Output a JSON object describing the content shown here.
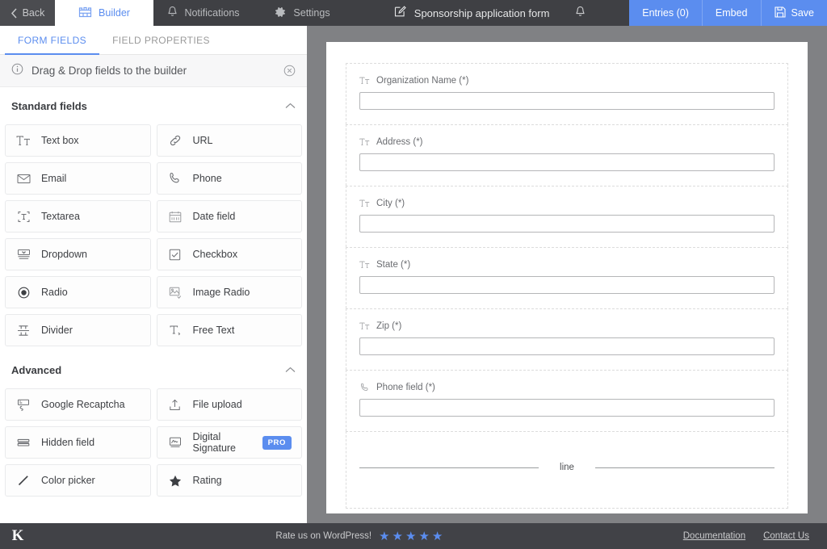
{
  "topbar": {
    "back_label": "Back",
    "tabs": [
      {
        "label": "Builder",
        "icon": "builder-icon",
        "active": true
      },
      {
        "label": "Notifications",
        "icon": "bell-icon",
        "active": false
      },
      {
        "label": "Settings",
        "icon": "gear-icon",
        "active": false
      }
    ],
    "form_title": "Sponsorship application form",
    "title_icon": "edit-pencil-icon",
    "bell_icon": "bell-icon",
    "actions": [
      {
        "label": "Entries (0)",
        "icon": null
      },
      {
        "label": "Embed",
        "icon": null
      },
      {
        "label": "Save",
        "icon": "save-disk-icon"
      }
    ],
    "accent_color": "#5b8def",
    "bar_color": "#3f4044"
  },
  "sidebar": {
    "tabs": [
      {
        "label": "FORM FIELDS",
        "active": true
      },
      {
        "label": "FIELD PROPERTIES",
        "active": false
      }
    ],
    "hint": {
      "text": "Drag & Drop fields to the builder",
      "info_icon": "info-circle-icon",
      "close_icon": "close-circle-icon"
    },
    "groups": [
      {
        "title": "Standard fields",
        "chevron": "chevron-up-icon",
        "fields": [
          {
            "label": "Text box",
            "icon": "text-box-icon"
          },
          {
            "label": "URL",
            "icon": "link-icon"
          },
          {
            "label": "Email",
            "icon": "envelope-icon"
          },
          {
            "label": "Phone",
            "icon": "phone-icon"
          },
          {
            "label": "Textarea",
            "icon": "textarea-icon"
          },
          {
            "label": "Date field",
            "icon": "calendar-icon"
          },
          {
            "label": "Dropdown",
            "icon": "dropdown-icon"
          },
          {
            "label": "Checkbox",
            "icon": "checkbox-icon"
          },
          {
            "label": "Radio",
            "icon": "radio-icon"
          },
          {
            "label": "Image Radio",
            "icon": "image-radio-icon"
          },
          {
            "label": "Divider",
            "icon": "divider-icon"
          },
          {
            "label": "Free Text",
            "icon": "free-text-icon"
          }
        ]
      },
      {
        "title": "Advanced",
        "chevron": "chevron-up-icon",
        "fields": [
          {
            "label": "Google Recaptcha",
            "icon": "recaptcha-icon"
          },
          {
            "label": "File upload",
            "icon": "upload-icon"
          },
          {
            "label": "Hidden field",
            "icon": "hidden-icon"
          },
          {
            "label": "Digital Signature",
            "icon": "signature-icon",
            "badge": "PRO"
          },
          {
            "label": "Color picker",
            "icon": "pencil-icon"
          },
          {
            "label": "Rating",
            "icon": "star-icon"
          }
        ]
      }
    ]
  },
  "canvas": {
    "fields": [
      {
        "type": "text",
        "label": "Organization Name (*)",
        "icon": "text-box-icon",
        "value": ""
      },
      {
        "type": "text",
        "label": "Address (*)",
        "icon": "text-box-icon",
        "value": ""
      },
      {
        "type": "text",
        "label": "City (*)",
        "icon": "text-box-icon",
        "value": ""
      },
      {
        "type": "text",
        "label": "State (*)",
        "icon": "text-box-icon",
        "value": ""
      },
      {
        "type": "text",
        "label": "Zip (*)",
        "icon": "text-box-icon",
        "value": ""
      },
      {
        "type": "phone",
        "label": "Phone field (*)",
        "icon": "phone-icon",
        "value": ""
      },
      {
        "type": "divider",
        "label": "line",
        "icon": "divider-icon"
      }
    ]
  },
  "footer": {
    "logo": "K",
    "rate_text": "Rate us on WordPress!",
    "stars": 5,
    "star_color": "#5b8def",
    "links": [
      {
        "label": "Documentation"
      },
      {
        "label": "Contact Us"
      }
    ]
  }
}
